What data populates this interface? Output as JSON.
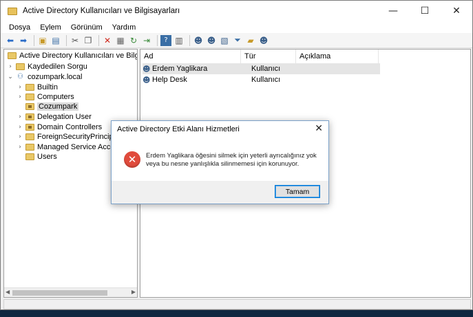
{
  "window": {
    "title": "Active Directory Kullanıcıları ve Bilgisayarları",
    "minimize": "—",
    "maximize": "☐",
    "close": "✕"
  },
  "menu": [
    "Dosya",
    "Eylem",
    "Görünüm",
    "Yardım"
  ],
  "toolbar_icons": [
    "back-icon",
    "forward-icon",
    "up-folder-icon",
    "console-tree-icon",
    "cut-icon",
    "copy-icon",
    "delete-icon",
    "properties-icon",
    "refresh-icon",
    "export-icon",
    "help-icon",
    "view-icon",
    "user-icon",
    "group-icon",
    "ou-icon",
    "filter-icon",
    "folder-icon",
    "users-icon"
  ],
  "tree": {
    "root": "Active Directory Kullanıcıları ve Bilgisaya",
    "saved_queries": "Kaydedilen Sorgu",
    "domain": "cozumpark.local",
    "children": [
      "Builtin",
      "Computers",
      "Cozumpark",
      "Delegation User",
      "Domain Controllers",
      "ForeignSecurityPrincipals",
      "Managed Service Accoun",
      "Users"
    ],
    "selected": "Cozumpark"
  },
  "list": {
    "columns": [
      "Ad",
      "Tür",
      "Açıklama"
    ],
    "rows": [
      {
        "name": "Erdem Yaglikara",
        "type": "Kullanıcı",
        "desc": ""
      },
      {
        "name": "Help Desk",
        "type": "Kullanıcı",
        "desc": ""
      }
    ]
  },
  "dialog": {
    "title": "Active Directory Etki Alanı Hizmetleri",
    "message_line1": "Erdem Yaglikara öğesini silmek için yeterli ayrıcalığınız yok",
    "message_line2": "veya bu nesne yanlışlıkla silinmemesi için korunuyor.",
    "ok_label": "Tamam",
    "close": "✕",
    "error_glyph": "✕"
  },
  "colors": {
    "accent": "#0078d7",
    "error": "#e04b3c",
    "folder": "#e9c867"
  }
}
